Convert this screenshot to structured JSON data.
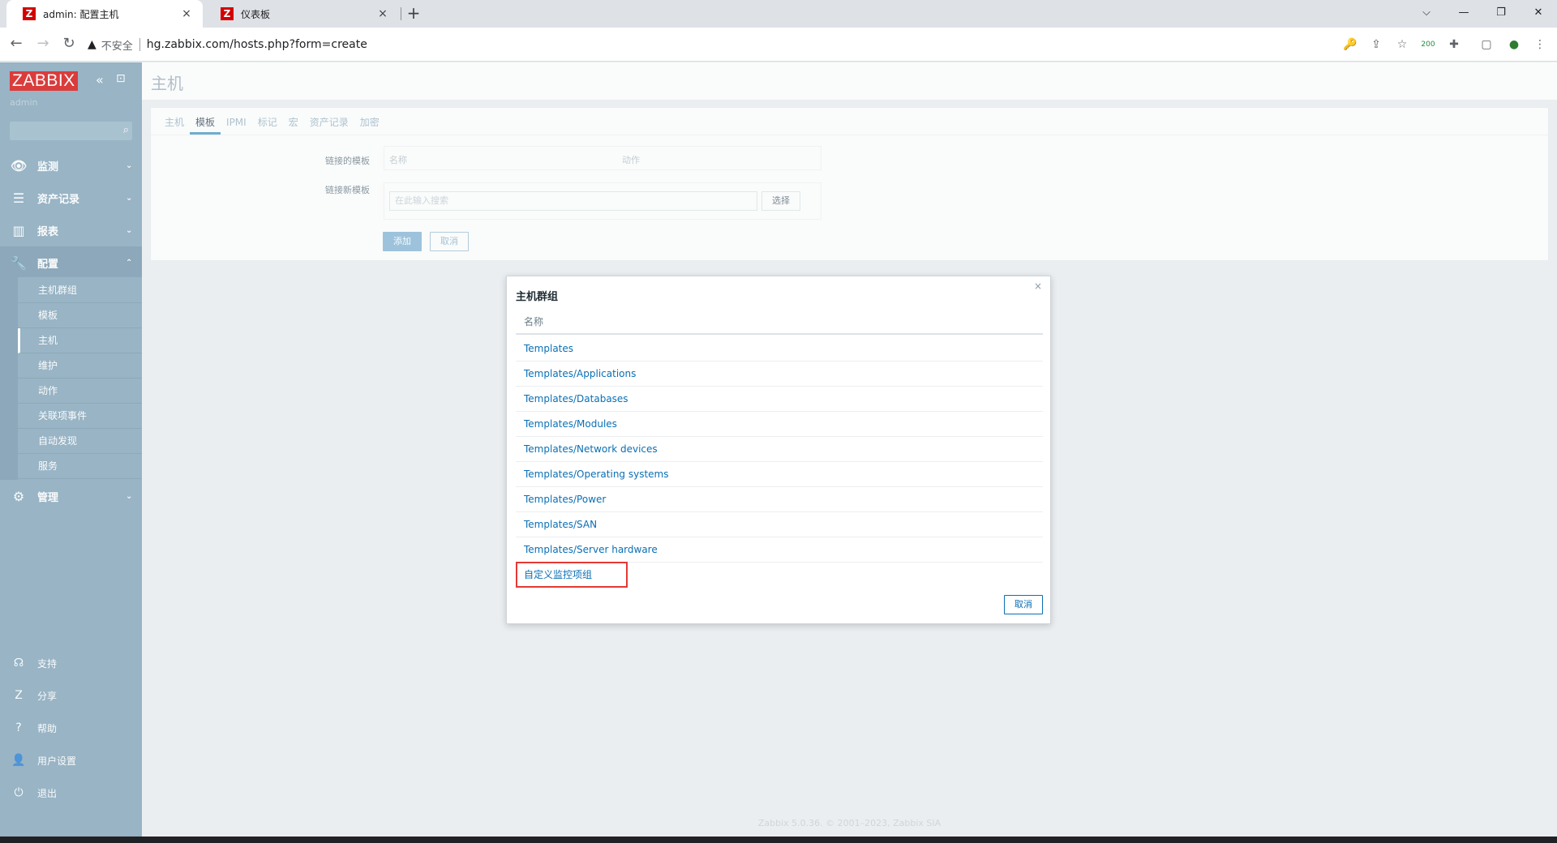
{
  "browser": {
    "tabs": [
      {
        "favicon": "Z",
        "title": "admin: 配置主机",
        "close": "×"
      },
      {
        "favicon": "Z",
        "title": "仪表板",
        "close": "×"
      }
    ],
    "new_tab": "+",
    "window_controls": {
      "dropdown": "⌵",
      "minimize": "—",
      "restore": "❐",
      "close": "✕"
    },
    "nav": {
      "back": "←",
      "forward": "→",
      "reload": "↻"
    },
    "address": {
      "warning_icon": "▲",
      "insecure_label": "不安全",
      "url": "hg.zabbix.com/hosts.php?form=create"
    },
    "extensions": {
      "key": "🔑",
      "share": "⇪",
      "star": "☆",
      "counter": "200",
      "puzzle": "✚",
      "sidepanel": "▢",
      "profile": "●",
      "menu": "⋮"
    }
  },
  "sidebar": {
    "logo": "ZABBIX",
    "collapse": "«",
    "kiosk": "⊡",
    "user": "admin",
    "search_icon": "⌕",
    "menu": [
      {
        "icon": "👁",
        "label": "监测",
        "arrow": "⌄"
      },
      {
        "icon": "☰",
        "label": "资产记录",
        "arrow": "⌄"
      },
      {
        "icon": "▥",
        "label": "报表",
        "arrow": "⌄"
      },
      {
        "icon": "🔧",
        "label": "配置",
        "arrow": "⌃"
      },
      {
        "icon": "⚙",
        "label": "管理",
        "arrow": "⌄"
      }
    ],
    "config_submenu": [
      "主机群组",
      "模板",
      "主机",
      "维护",
      "动作",
      "关联项事件",
      "自动发现",
      "服务"
    ],
    "bottom": [
      {
        "icon": "☊",
        "label": "支持"
      },
      {
        "icon": "Z",
        "label": "分享"
      },
      {
        "icon": "?",
        "label": "帮助"
      },
      {
        "icon": "👤",
        "label": "用户设置"
      },
      {
        "icon": "⏻",
        "label": "退出"
      }
    ]
  },
  "page": {
    "title": "主机",
    "tabs": [
      "主机",
      "模板",
      "IPMI",
      "标记",
      "宏",
      "资产记录",
      "加密"
    ],
    "linked_templates_label": "链接的模板",
    "linked_col_name": "名称",
    "linked_col_action": "动作",
    "new_templates_label": "链接新模板",
    "search_placeholder": "在此输入搜索",
    "select_button": "选择",
    "add_button": "添加",
    "cancel_button": "取消",
    "footer": "Zabbix 5.0.36. © 2001–2023, Zabbix SIA"
  },
  "dialog": {
    "title": "主机群组",
    "close": "×",
    "column_name": "名称",
    "rows": [
      "Templates",
      "Templates/Applications",
      "Templates/Databases",
      "Templates/Modules",
      "Templates/Network devices",
      "Templates/Operating systems",
      "Templates/Power",
      "Templates/SAN",
      "Templates/Server hardware",
      "自定义监控项组"
    ],
    "cancel": "取消",
    "highlight_color": "#e53935"
  }
}
